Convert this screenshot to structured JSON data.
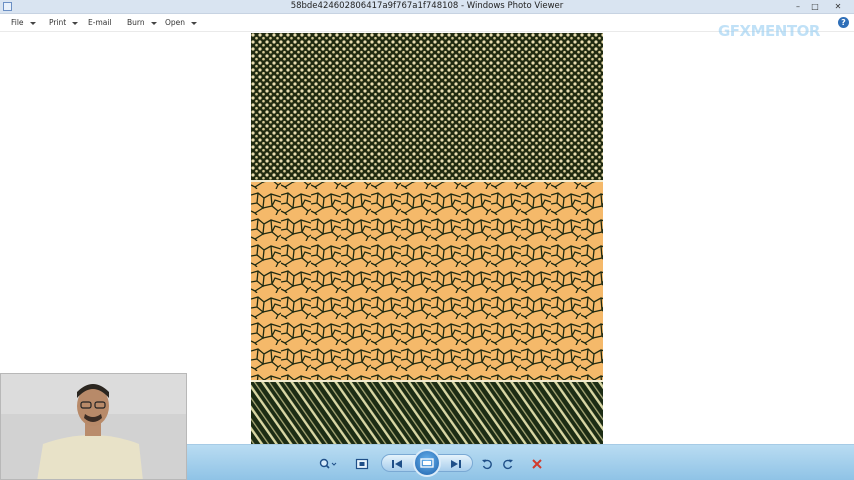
{
  "window": {
    "title": "58bde424602806417a9f767a1f748108 - Windows Photo Viewer",
    "controls": [
      "minimize-icon",
      "restore-icon",
      "close-icon"
    ]
  },
  "menu": {
    "items": [
      {
        "label": "File",
        "has_arrow": true
      },
      {
        "label": "Print",
        "has_arrow": true
      },
      {
        "label": "E-mail",
        "has_arrow": false
      },
      {
        "label": "Burn",
        "has_arrow": true
      },
      {
        "label": "Open",
        "has_arrow": true
      }
    ],
    "help_label": "?"
  },
  "watermark": {
    "text": "GFXMENTOR"
  },
  "image": {
    "sections": [
      {
        "name": "dark-dotted-pattern",
        "base": "#202a10",
        "accent": "#e9ddb0"
      },
      {
        "name": "cracked-orange-pattern",
        "base": "#f5b96a",
        "accent": "#1e2a12"
      },
      {
        "name": "striped-green-pattern",
        "base": "#1c2c14",
        "accent": "#d9d7a4"
      }
    ]
  },
  "toolbar": {
    "buttons": [
      "zoom-icon",
      "fit-window-icon",
      "previous-icon",
      "slideshow-icon",
      "next-icon",
      "rotate-left-icon",
      "rotate-right-icon",
      "delete-icon"
    ]
  },
  "colors": {
    "toolbar_top": "#b9dcf2",
    "toolbar_bottom": "#8fc3e6",
    "delete": "#d23a2c",
    "accent_blue": "#2f6fb8"
  }
}
